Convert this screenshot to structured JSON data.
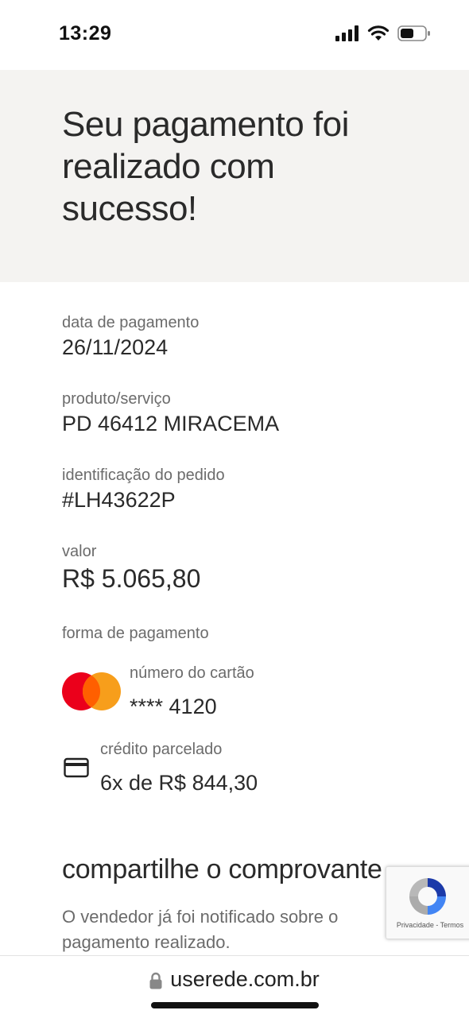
{
  "status_bar": {
    "time": "13:29"
  },
  "hero": {
    "title": "Seu pagamento foi realizado com sucesso!"
  },
  "details": {
    "payment_date": {
      "label": "data de pagamento",
      "value": "26/11/2024"
    },
    "product": {
      "label": "produto/serviço",
      "value": "PD 46412 MIRACEMA"
    },
    "order_id": {
      "label": "identificação do pedido",
      "value": "#LH43622P"
    },
    "amount": {
      "label": "valor",
      "value": "R$ 5.065,80"
    },
    "payment_method": {
      "label": "forma de pagamento",
      "card_label": "número do cartão",
      "card_number": "**** 4120",
      "installment_label": "crédito parcelado",
      "installment_value": "6x de R$ 844,30"
    }
  },
  "share": {
    "title": "compartilhe o comprovante",
    "text": "O vendedor já foi notificado sobre o pagamento realizado."
  },
  "recaptcha": {
    "links": "Privacidade - Termos"
  },
  "browser": {
    "url": "userede.com.br"
  },
  "colors": {
    "mastercard_red": "#eb001b",
    "mastercard_orange": "#f79e1b",
    "hero_bg": "#f4f3f1"
  }
}
